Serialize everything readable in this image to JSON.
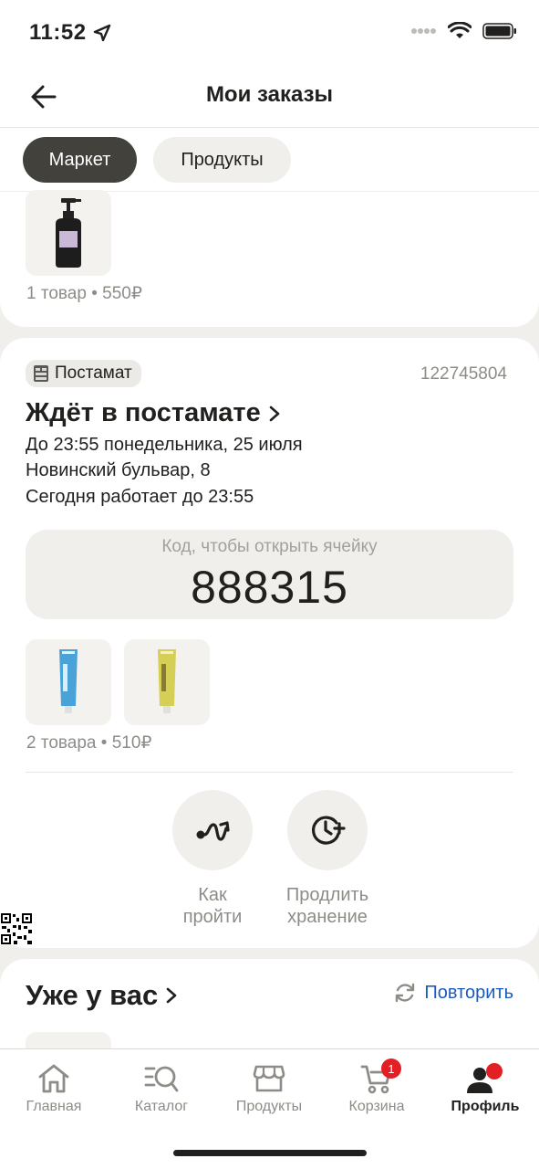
{
  "status_bar": {
    "time": "11:52"
  },
  "header": {
    "title": "Мои заказы"
  },
  "tabs": [
    {
      "label": "Маркет",
      "active": true
    },
    {
      "label": "Продукты",
      "active": false
    }
  ],
  "previous_order": {
    "summary": "1 товар • 550₽"
  },
  "order": {
    "badge": "Постамат",
    "number": "122745804",
    "status": "Ждёт в постамате",
    "deadline": "До 23:55 понедельника, 25 июля",
    "address": "Новинский бульвар, 8",
    "hours": "Сегодня работает до 23:55",
    "code_label": "Код, чтобы открыть ячейку",
    "code": "888315",
    "summary": "2 товара • 510₽",
    "actions": [
      {
        "line1": "Как",
        "line2": "пройти",
        "icon": "route-icon"
      },
      {
        "line1": "Продлить",
        "line2": "хранение",
        "icon": "clock-plus-icon"
      }
    ]
  },
  "already": {
    "title": "Уже у вас",
    "repeat_label": "Повторить"
  },
  "tabbar": {
    "items": [
      {
        "label": "Главная",
        "icon": "home-icon"
      },
      {
        "label": "Каталог",
        "icon": "catalog-search-icon"
      },
      {
        "label": "Продукты",
        "icon": "store-icon"
      },
      {
        "label": "Корзина",
        "icon": "cart-icon",
        "badge": "1"
      },
      {
        "label": "Профиль",
        "icon": "profile-icon",
        "active": true
      }
    ]
  },
  "colors": {
    "accent": "#1a5cbd",
    "badge_red": "#e31e24",
    "dark_chip": "#43413c"
  }
}
